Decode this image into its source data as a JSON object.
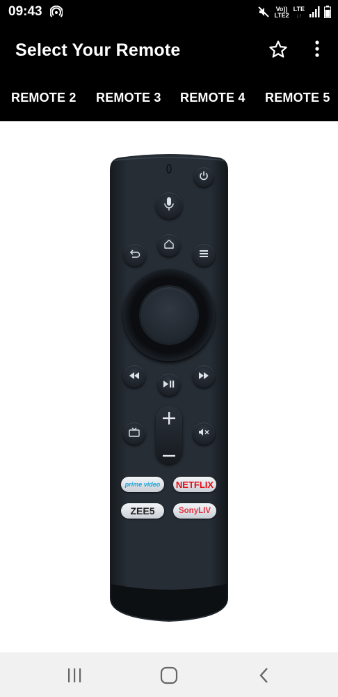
{
  "status_bar": {
    "time": "09:43",
    "volte_label": "Vo))",
    "lte2_label": "LTE2",
    "lte_label": "LTE"
  },
  "app_bar": {
    "title": "Select Your Remote",
    "icons": [
      "star-outline-icon",
      "more-vert-icon"
    ]
  },
  "tabs": [
    {
      "label": "REMOTE 2"
    },
    {
      "label": "REMOTE 3"
    },
    {
      "label": "REMOTE 4"
    },
    {
      "label": "REMOTE 5"
    }
  ],
  "remote": {
    "buttons": [
      "power-icon",
      "mic-icon",
      "back-icon",
      "home-icon",
      "menu-icon",
      "rewind-icon",
      "play-pause-icon",
      "fast-forward-icon",
      "tv-icon",
      "volume-up-icon",
      "volume-down-icon",
      "mute-icon"
    ],
    "apps": {
      "prime": "prime video",
      "netflix": "NETFLIX",
      "zee5": "ZEE5",
      "sonyliv": "SonyLIV"
    }
  },
  "nav_bar": {
    "icons": [
      "recents-icon",
      "home-icon",
      "back-icon"
    ]
  },
  "colors": {
    "app_bar": "#000000",
    "content_bg": "#ffffff",
    "remote_body": "#1f252c",
    "nav_bar": "#f1f1f1",
    "netflix": "#e50914",
    "prime": "#1aa3d9",
    "sonyliv": "#e03240"
  }
}
